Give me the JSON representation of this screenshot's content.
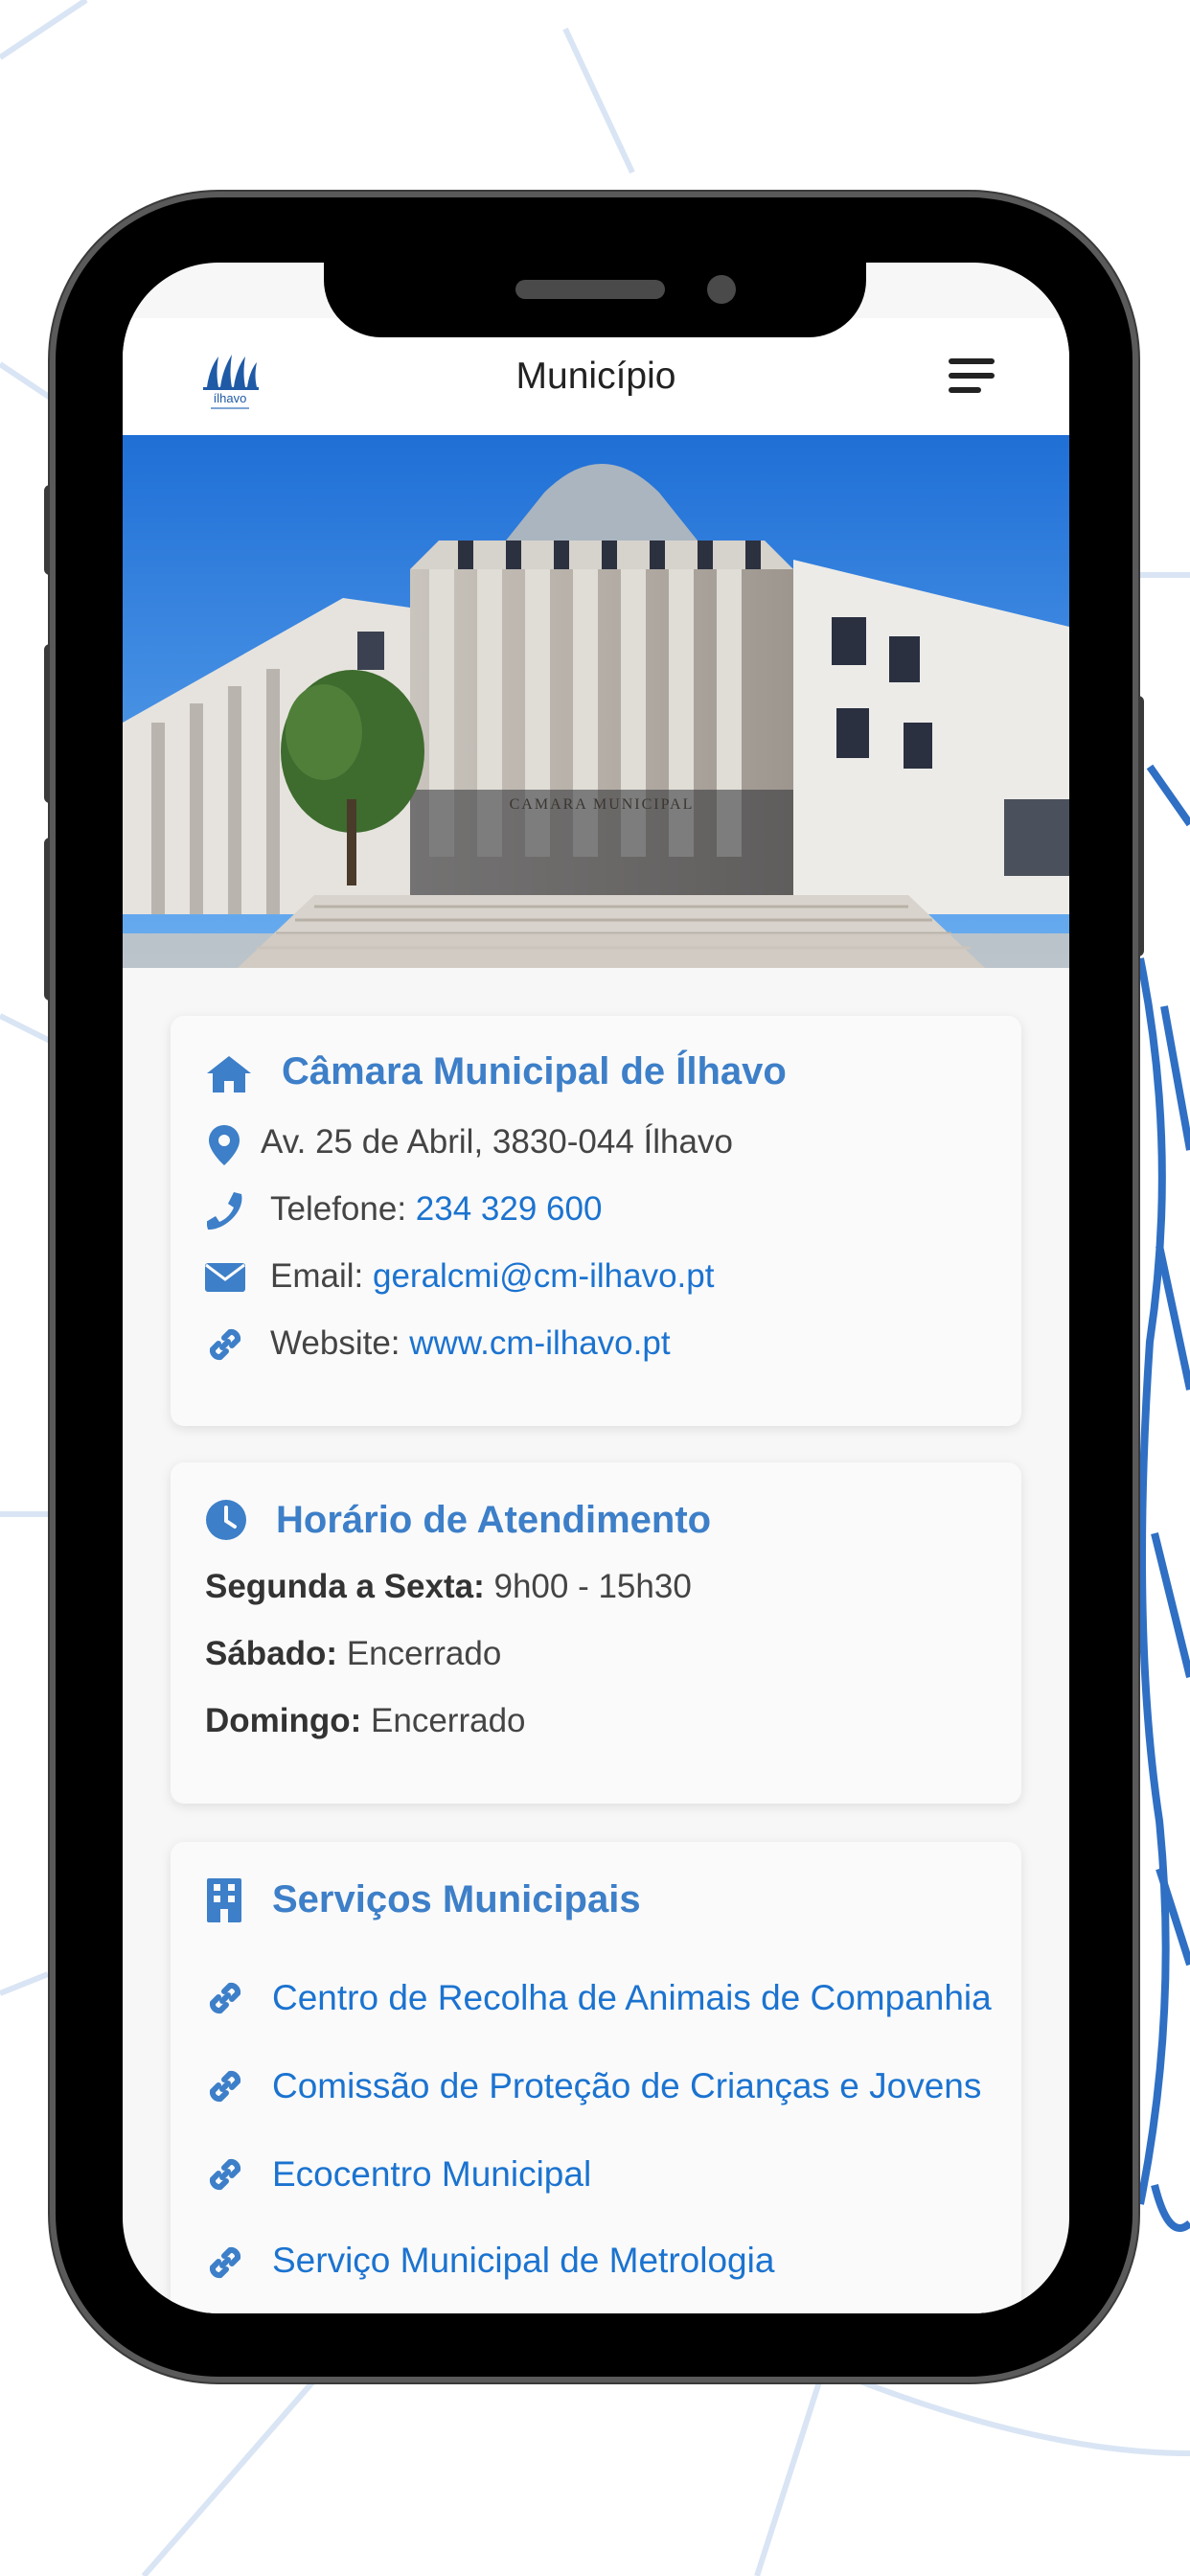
{
  "header": {
    "title": "Município",
    "logo_text": "ílhavo"
  },
  "contact": {
    "title": "Câmara Municipal de Ílhavo",
    "address": "Av. 25 de Abril, 3830-044 Ílhavo",
    "phone_label": "Telefone:",
    "phone_value": "234 329 600",
    "email_label": "Email:",
    "email_value": "geralcmi@cm-ilhavo.pt",
    "website_label": "Website:",
    "website_value": "www.cm-ilhavo.pt"
  },
  "hours": {
    "title": "Horário de Atendimento",
    "rows": [
      {
        "day": "Segunda a Sexta:",
        "value": "9h00 - 15h30"
      },
      {
        "day": "Sábado:",
        "value": "Encerrado"
      },
      {
        "day": "Domingo:",
        "value": "Encerrado"
      }
    ]
  },
  "services": {
    "title": "Serviços Municipais",
    "items": [
      "Centro de Recolha de Animais de Companhia",
      "Comissão de Proteção de Crianças e Jovens",
      "Ecocentro Municipal",
      "Serviço Municipal de Metrologia"
    ]
  },
  "hero": {
    "building_sign": "CAMARA MUNICIPAL"
  },
  "colors": {
    "accent": "#3d7fc8",
    "link": "#1b73d0",
    "text": "#444444"
  },
  "icons": [
    "home-icon",
    "map-pin-icon",
    "phone-icon",
    "envelope-icon",
    "link-icon",
    "clock-icon",
    "building-icon",
    "menu-icon"
  ]
}
